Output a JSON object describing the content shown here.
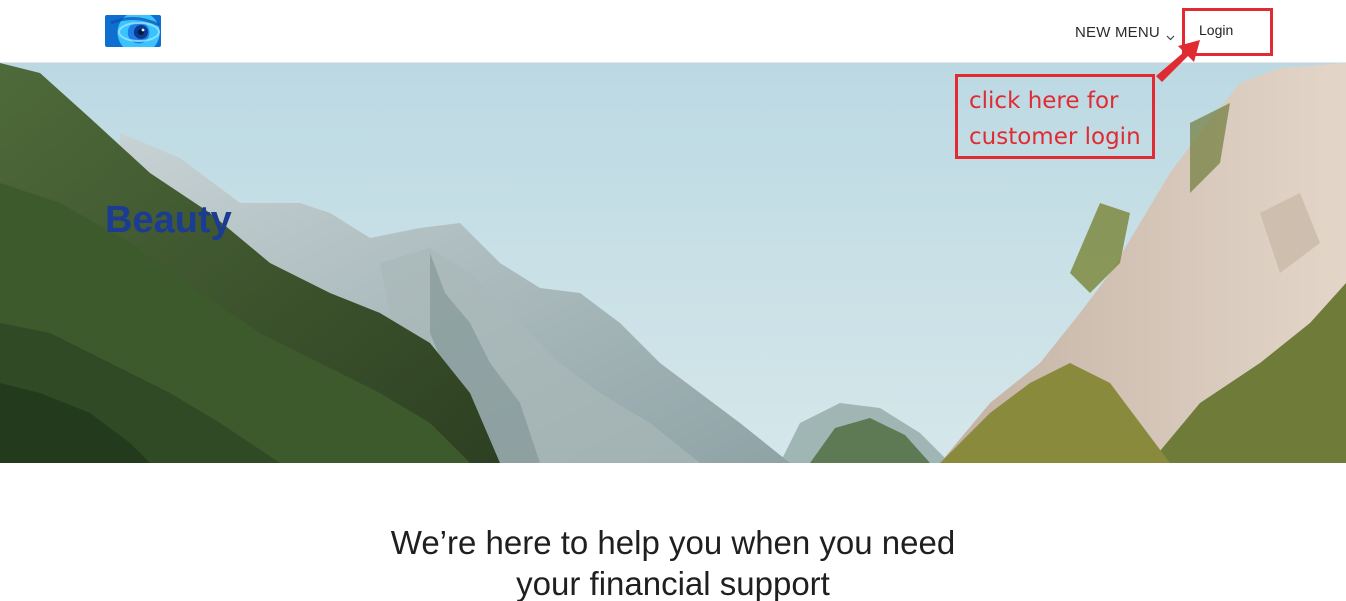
{
  "header": {
    "logo_icon": "eye-logo-icon",
    "nav_menu_label": "NEW MENU",
    "nav_menu_icon": "chevron-down-icon",
    "login_label": "Login"
  },
  "annotation": {
    "callout_text": "click here for\ncustomer login",
    "arrow_icon": "red-arrow-icon",
    "color": "#e02b33"
  },
  "hero": {
    "title": "Beauty",
    "title_color": "#1c3b93",
    "image": "mountain-valley-photo"
  },
  "main": {
    "headline_line1": "We’re here to help you when you need",
    "headline_line2": "your financial support"
  }
}
